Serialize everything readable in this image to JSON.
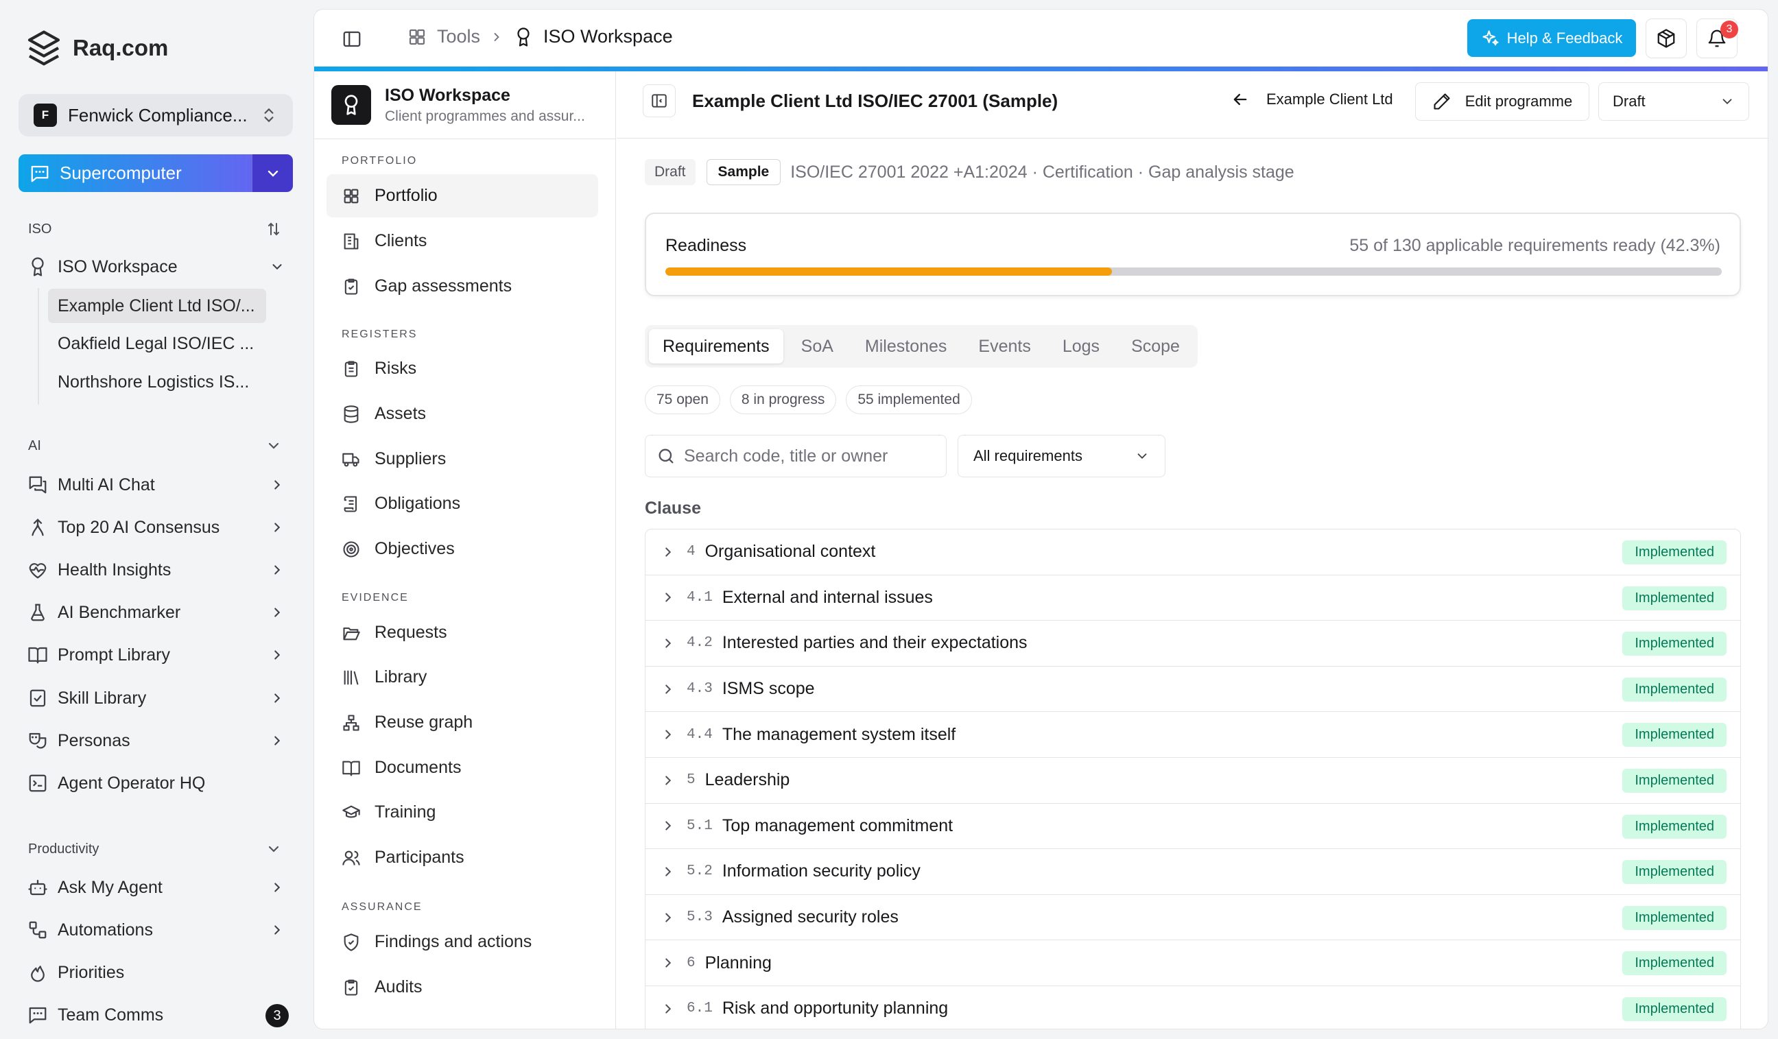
{
  "app": {
    "brand": "Raq.com"
  },
  "org": {
    "initial": "F",
    "name": "Fenwick Compliance..."
  },
  "supercomputer": {
    "label": "Supercomputer"
  },
  "sidebar": {
    "iso_header": "ISO",
    "iso_workspace": "ISO Workspace",
    "iso_children": [
      "Example Client Ltd ISO/...",
      "Oakfield Legal ISO/IEC ...",
      "Northshore Logistics IS..."
    ],
    "ai_header": "AI",
    "ai_items": [
      "Multi AI Chat",
      "Top 20 AI Consensus",
      "Health Insights",
      "AI Benchmarker",
      "Prompt Library",
      "Skill Library",
      "Personas",
      "Agent Operator HQ"
    ],
    "productivity_header": "Productivity",
    "productivity_items": [
      "Ask My Agent",
      "Automations",
      "Priorities",
      "Team Comms"
    ],
    "team_comms_badge": "3"
  },
  "topbar": {
    "crumb_tools": "Tools",
    "crumb_current": "ISO Workspace",
    "help_label": "Help & Feedback",
    "notif_count": "3"
  },
  "module": {
    "title": "ISO Workspace",
    "subtitle": "Client programmes and assur...",
    "groups": {
      "portfolio": "PORTFOLIO",
      "registers": "REGISTERS",
      "evidence": "EVIDENCE",
      "assurance": "ASSURANCE"
    },
    "portfolio_items": [
      "Portfolio",
      "Clients",
      "Gap assessments"
    ],
    "registers_items": [
      "Risks",
      "Assets",
      "Suppliers",
      "Obligations",
      "Objectives"
    ],
    "evidence_items": [
      "Requests",
      "Library",
      "Reuse graph",
      "Documents",
      "Training",
      "Participants"
    ],
    "assurance_items": [
      "Findings and actions",
      "Audits"
    ]
  },
  "content": {
    "title": "Example Client Ltd ISO/IEC 27001 (Sample)",
    "back_label": "Example Client Ltd",
    "edit_label": "Edit programme",
    "status_select": "Draft",
    "chip_draft": "Draft",
    "chip_sample": "Sample",
    "meta": "ISO/IEC 27001 2022 +A1:2024 · Certification · Gap analysis stage",
    "readiness_label": "Readiness",
    "readiness_summary": "55 of 130 applicable requirements ready (42.3%)",
    "readiness_fraction": 0.423,
    "tabs": [
      "Requirements",
      "SoA",
      "Milestones",
      "Events",
      "Logs",
      "Scope"
    ],
    "counts": [
      "75 open",
      "8 in progress",
      "55 implemented"
    ],
    "search_placeholder": "Search code, title or owner",
    "filter_label": "All requirements",
    "clause_header": "Clause",
    "rows": [
      {
        "code": "4",
        "title": "Organisational context",
        "status": "Implemented"
      },
      {
        "code": "4.1",
        "title": "External and internal issues",
        "status": "Implemented"
      },
      {
        "code": "4.2",
        "title": "Interested parties and their expectations",
        "status": "Implemented"
      },
      {
        "code": "4.3",
        "title": "ISMS scope",
        "status": "Implemented"
      },
      {
        "code": "4.4",
        "title": "The management system itself",
        "status": "Implemented"
      },
      {
        "code": "5",
        "title": "Leadership",
        "status": "Implemented"
      },
      {
        "code": "5.1",
        "title": "Top management commitment",
        "status": "Implemented"
      },
      {
        "code": "5.2",
        "title": "Information security policy",
        "status": "Implemented"
      },
      {
        "code": "5.3",
        "title": "Assigned security roles",
        "status": "Implemented"
      },
      {
        "code": "6",
        "title": "Planning",
        "status": "Implemented"
      },
      {
        "code": "6.1",
        "title": "Risk and opportunity planning",
        "status": "Implemented"
      }
    ]
  }
}
